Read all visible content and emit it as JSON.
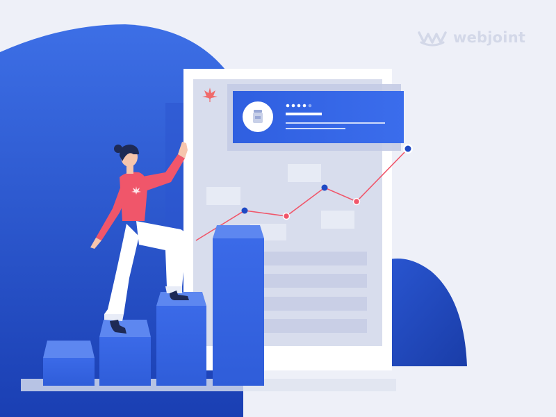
{
  "brand": {
    "name": "webjoint",
    "logo_icon": "crown-w-icon"
  },
  "colors": {
    "background": "#eef0f8",
    "blob_dark": "#1f49c4",
    "blob_light": "#3d6fe6",
    "primary": "#3567e6",
    "bar_top": "#5d87f0",
    "bar_side": "#2c55cc",
    "accent_red": "#f0566a",
    "leaf": "#f06a6a",
    "logo_gray": "#d3d8e8"
  },
  "icons": {
    "leaf": "cannabis-leaf-icon",
    "product": "jar-icon"
  },
  "card": {
    "rating_filled": 4,
    "rating_total": 5
  },
  "illustration": {
    "line_points": 6,
    "highlight_point": 6,
    "steps": 4
  }
}
